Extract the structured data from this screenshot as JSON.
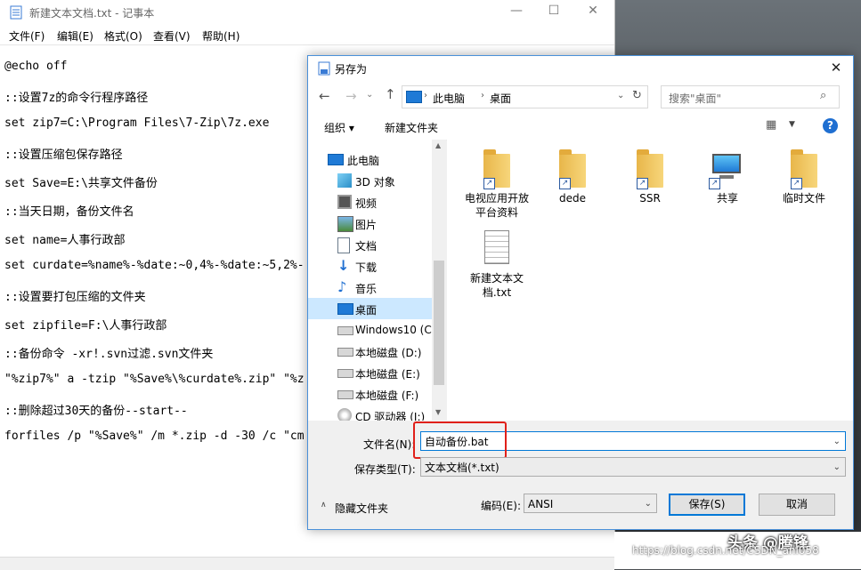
{
  "notepad": {
    "title": "新建文本文档.txt - 记事本",
    "menus": [
      "文件(F)",
      "编辑(E)",
      "格式(O)",
      "查看(V)",
      "帮助(H)"
    ],
    "lines": [
      "@echo off",
      "::设置7z的命令行程序路径",
      "set zip7=C:\\Program Files\\7-Zip\\7z.exe",
      "::设置压缩包保存路径",
      "set Save=E:\\共享文件备份",
      "::当天日期，备份文件名",
      "set name=人事行政部",
      "set curdate=%name%-%date:~0,4%-%date:~5,2%-",
      "::设置要打包压缩的文件夹",
      "set zipfile=F:\\人事行政部",
      "::备份命令 -xr!.svn过滤.svn文件夹",
      "\"%zip7%\" a -tzip \"%Save%\\%curdate%.zip\" \"%z",
      "::删除超过30天的备份--start--",
      "forfiles /p \"%Save%\" /m *.zip -d -30 /c \"cm"
    ]
  },
  "dialog": {
    "title": "另存为",
    "breadcrumb": [
      "此电脑",
      "桌面"
    ],
    "search_placeholder": "搜索\"桌面\"",
    "organize_label": "组织 ▾",
    "new_folder_label": "新建文件夹",
    "nav_items": [
      {
        "label": "此电脑",
        "icon": "computer-icon"
      },
      {
        "label": "3D 对象",
        "icon": "3d-objects-icon"
      },
      {
        "label": "视频",
        "icon": "video-icon"
      },
      {
        "label": "图片",
        "icon": "pictures-icon"
      },
      {
        "label": "文档",
        "icon": "documents-icon"
      },
      {
        "label": "下载",
        "icon": "download-icon"
      },
      {
        "label": "音乐",
        "icon": "music-icon"
      },
      {
        "label": "桌面",
        "icon": "desktop-icon"
      },
      {
        "label": "Windows10 (C:",
        "icon": "drive-c-icon"
      },
      {
        "label": "本地磁盘 (D:)",
        "icon": "drive-icon"
      },
      {
        "label": "本地磁盘 (E:)",
        "icon": "drive-icon"
      },
      {
        "label": "本地磁盘 (F:)",
        "icon": "drive-icon"
      },
      {
        "label": "CD 驱动器 (I:)",
        "icon": "cd-drive-icon"
      }
    ],
    "files": [
      {
        "label": "电视应用开放平台资料",
        "type": "folder-shortcut"
      },
      {
        "label": "dede",
        "type": "folder-shortcut"
      },
      {
        "label": "SSR",
        "type": "folder-shortcut"
      },
      {
        "label": "共享",
        "type": "computer-shortcut"
      },
      {
        "label": "临时文件",
        "type": "folder-shortcut"
      },
      {
        "label": "新建文本文档.txt",
        "type": "text-file"
      }
    ],
    "filename_label": "文件名(N):",
    "filename_value": "自动备份.bat",
    "filetype_label": "保存类型(T):",
    "filetype_value": "文本文档(*.txt)",
    "hide_folders_label": "隐藏文件夹",
    "encoding_label": "编码(E):",
    "encoding_value": "ANSI",
    "save_label": "保存(S)",
    "cancel_label": "取消"
  },
  "watermark": {
    "brand": "头条 @腾锋",
    "url": "https://blog.csdn.net/CSDN_anl058"
  },
  "colors": {
    "accent": "#0078d7",
    "highlight_box": "#e0201a",
    "selected_nav": "#cce8ff"
  }
}
